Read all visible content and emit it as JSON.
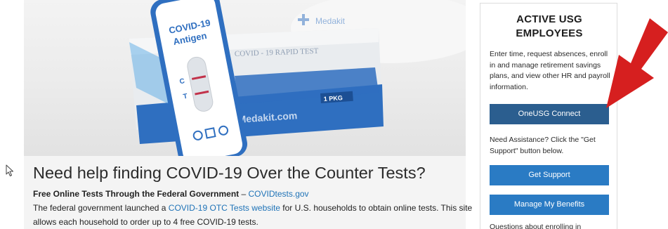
{
  "article": {
    "hero_image": {
      "kit_brand": "Medakit",
      "box_text": "COVID - 19 RAPID TEST",
      "box_url": "Medakit.com",
      "box_badge": "1 PKG",
      "test_label_line1": "COVID-19",
      "test_label_line2": "Antigen",
      "marker_c": "C",
      "marker_t": "T"
    },
    "headline": "Need help finding COVID-19 Over the Counter Tests?",
    "subhead_bold": "Free Online Tests Through the Federal Government",
    "subhead_sep": " – ",
    "subhead_link": "COVIDtests.gov",
    "para_start": "The federal government launched a ",
    "para_link": "COVID-19 OTC Tests website",
    "para_end": " for U.S. households to obtain online tests. This site",
    "para_line2": "allows each household to order up to 4 free COVID-19 tests."
  },
  "sidebar": {
    "title_line1": "ACTIVE USG",
    "title_line2": "EMPLOYEES",
    "intro": "Enter time, request absences, enroll in and manage retirement savings plans, and view other HR and payroll information.",
    "connect_button": "OneUSG Connect",
    "assist_text": "Need Assistance? Click the \"Get Support\" button below.",
    "support_button": "Get Support",
    "benefits_button": "Manage My Benefits",
    "questions_text": "Questions about enrolling in"
  },
  "colors": {
    "link": "#1f73b7",
    "connect_button": "#2b5e8f",
    "support_button": "#2a7bc4",
    "annotation_arrow": "#d61f1f"
  },
  "icons": [
    "mouse-pointer-icon",
    "red-annotation-arrow"
  ]
}
